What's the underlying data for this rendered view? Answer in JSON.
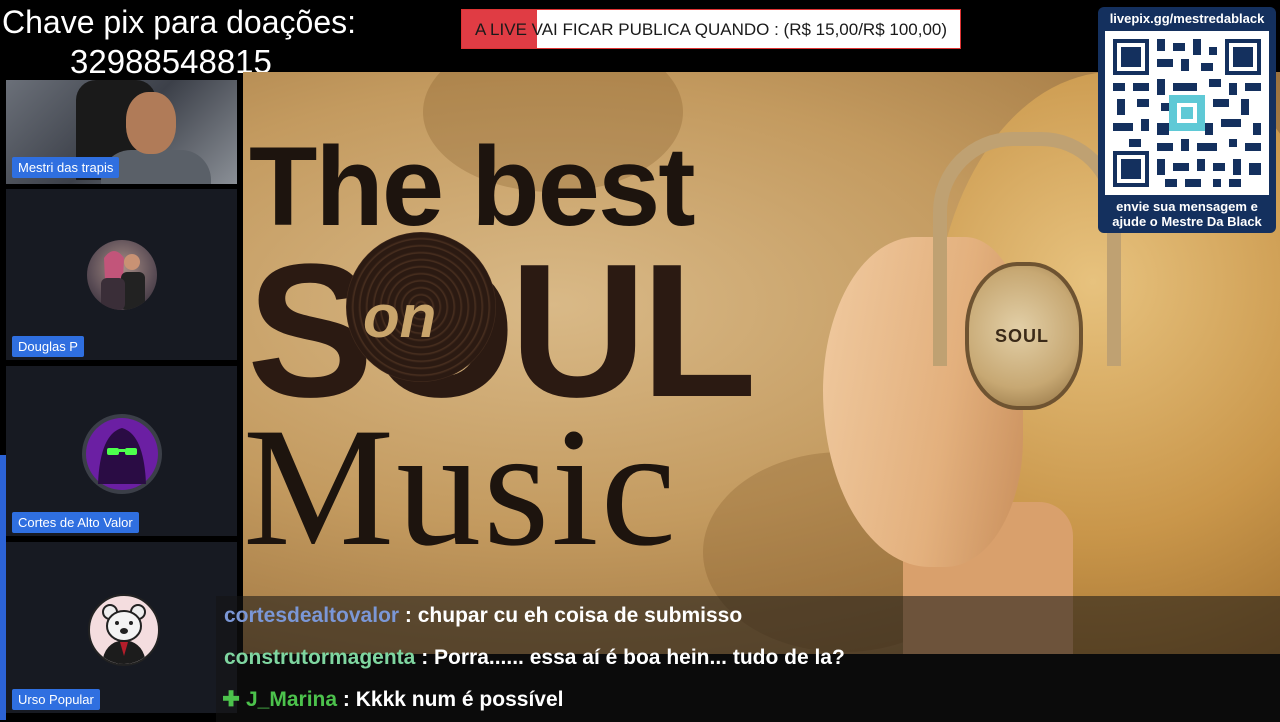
{
  "pix": {
    "label": "Chave pix para doações:",
    "key": "32988548815"
  },
  "live_banner": {
    "text": "A LIVE VAI FICAR PUBLICA QUANDO : (R$ 15,00/R$ 100,00)",
    "raised": 15,
    "goal": 100,
    "progress_fraction": 0.15,
    "fill_color": "#e03c44"
  },
  "video": {
    "title_line1": "The best",
    "title_line2": "SOUL",
    "title_on": "on",
    "title_line3": "Music",
    "headphone_text": "SOUL"
  },
  "participants": [
    {
      "name": "Mestri das trapis",
      "type": "camera"
    },
    {
      "name": "Douglas P",
      "type": "avatar",
      "avatar": "couple-photo"
    },
    {
      "name": "Cortes de Alto Valor",
      "type": "avatar",
      "avatar": "hooded-figure-purple"
    },
    {
      "name": "Urso Popular",
      "type": "avatar",
      "avatar": "bear-in-suit"
    }
  ],
  "qr": {
    "url": "livepix.gg/mestredablack",
    "caption_line1": "envie sua mensagem e",
    "caption_line2": "ajude o Mestre Da Black",
    "panel_color": "#14305e"
  },
  "chat": [
    {
      "user": "cortesdealtovalor",
      "message": "chupar cu eh coisa de submisso",
      "user_color": "#7b97d6",
      "badge": null
    },
    {
      "user": "construtormagenta",
      "message": "Porra...... essa aí é boa hein... tudo de la?",
      "user_color": "#7fd6a0",
      "badge": null
    },
    {
      "user": "J_Marina",
      "message": "Kkkk num é possível",
      "user_color": "#4cc24c",
      "badge": "green-plus-icon"
    }
  ]
}
